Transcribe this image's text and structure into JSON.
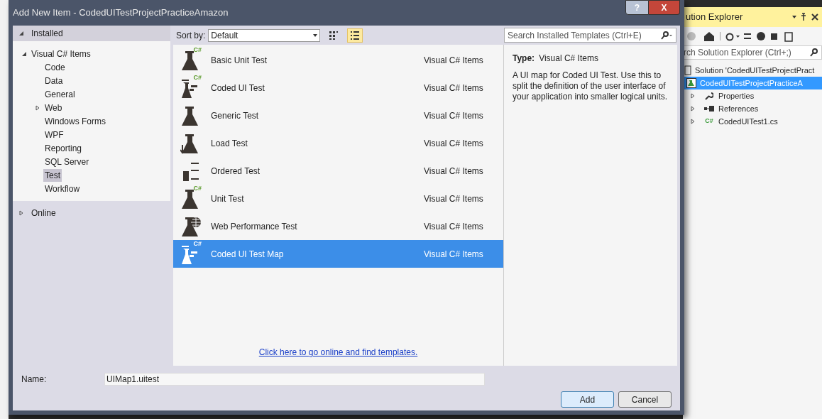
{
  "dialog": {
    "title": "Add New Item - CodedUITestProjectPracticeAmazon",
    "help": "?",
    "close": "X"
  },
  "sidebar": {
    "sections": [
      {
        "label": "Installed",
        "expanded": true,
        "items": [
          {
            "label": "Visual C# Items",
            "expanded": true,
            "selected": false,
            "children": [
              {
                "label": "Code",
                "selected": false
              },
              {
                "label": "Data",
                "selected": false
              },
              {
                "label": "General",
                "selected": false
              },
              {
                "label": "Web",
                "selected": false,
                "expanded": false
              },
              {
                "label": "Windows Forms",
                "selected": false
              },
              {
                "label": "WPF",
                "selected": false
              },
              {
                "label": "Reporting",
                "selected": false
              },
              {
                "label": "SQL Server",
                "selected": false
              },
              {
                "label": "Test",
                "selected": true
              },
              {
                "label": "Workflow",
                "selected": false
              }
            ]
          }
        ]
      },
      {
        "label": "Online",
        "expanded": false
      }
    ]
  },
  "toolbar": {
    "sort_label": "Sort by:",
    "sort_value": "Default",
    "views": [
      {
        "kind": "grid",
        "selected": false
      },
      {
        "kind": "list",
        "selected": true
      }
    ]
  },
  "search": {
    "placeholder": "Search Installed Templates (Ctrl+E)"
  },
  "templates": [
    {
      "name": "Basic Unit Test",
      "category": "Visual C# Items",
      "kind": "flask",
      "badge": "C#",
      "selected": false
    },
    {
      "name": "Coded UI Test",
      "category": "Visual C# Items",
      "kind": "coded",
      "badge": "C#",
      "selected": false
    },
    {
      "name": "Generic Test",
      "category": "Visual C# Items",
      "kind": "flask",
      "selected": false
    },
    {
      "name": "Load Test",
      "category": "Visual C# Items",
      "kind": "load",
      "selected": false
    },
    {
      "name": "Ordered Test",
      "category": "Visual C# Items",
      "kind": "ordered",
      "selected": false
    },
    {
      "name": "Unit Test",
      "category": "Visual C# Items",
      "kind": "flask",
      "badge": "C#",
      "selected": false
    },
    {
      "name": "Web Performance Test",
      "category": "Visual C# Items",
      "kind": "web",
      "selected": false
    },
    {
      "name": "Coded UI Test Map",
      "category": "Visual C# Items",
      "kind": "coded",
      "badge": "C#",
      "selected": true
    }
  ],
  "online_link": "Click here to go online and find templates.",
  "details": {
    "type_label": "Type:",
    "type_value": "Visual C# Items",
    "description": "A UI map for Coded UI Test. Use this to split the definition of the user interface of your application into smaller logical units."
  },
  "name_field": {
    "label": "Name:",
    "value": "UIMap1.uitest"
  },
  "buttons": [
    {
      "label": "Add",
      "kind": "default"
    },
    {
      "label": "Cancel",
      "kind": "normal"
    }
  ],
  "solution_explorer": {
    "title": "ution Explorer",
    "search_placeholder": "rch Solution Explorer (Ctrl+;)",
    "tree": [
      {
        "label": "Solution 'CodedUITestProjectPract",
        "kind": "solution",
        "selected": false,
        "children": [
          {
            "label": "CodedUITestProjectPracticeA",
            "kind": "project",
            "selected": true,
            "children": [
              {
                "label": "Properties",
                "kind": "properties",
                "selected": false,
                "expanded": false
              },
              {
                "label": "References",
                "kind": "references",
                "selected": false,
                "expanded": false
              },
              {
                "label": "CodedUITest1.cs",
                "kind": "csfile",
                "badge": "C#",
                "selected": false,
                "expanded": false
              }
            ]
          }
        ]
      }
    ]
  }
}
